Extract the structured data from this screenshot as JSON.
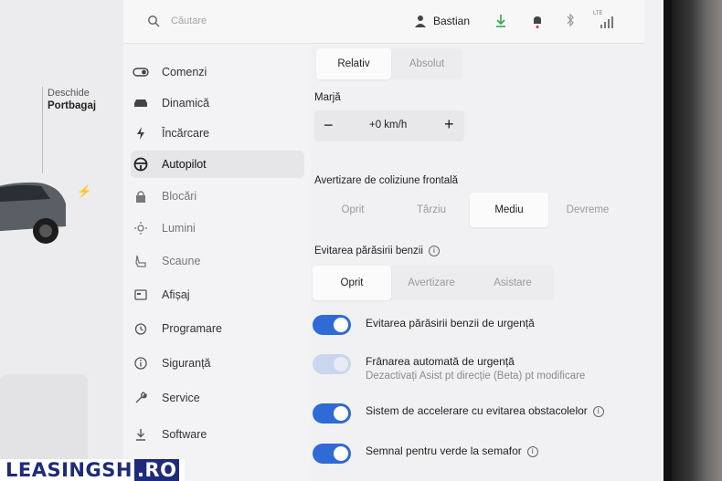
{
  "topbar": {
    "search_placeholder": "Căutare",
    "user_name": "Bastian",
    "signal_label": "LTE"
  },
  "car_panel": {
    "trunk_line1": "Deschide",
    "trunk_line2": "Portbagaj"
  },
  "menu": {
    "items": [
      {
        "label": "Comenzi",
        "icon": "toggle-icon"
      },
      {
        "label": "Dinamică",
        "icon": "car-icon"
      },
      {
        "label": "Încărcare",
        "icon": "bolt-icon"
      },
      {
        "label": "Autopilot",
        "icon": "steering-wheel-icon"
      },
      {
        "label": "Blocări",
        "icon": "lock-icon"
      },
      {
        "label": "Lumini",
        "icon": "light-icon"
      },
      {
        "label": "Scaune",
        "icon": "seat-icon"
      },
      {
        "label": "Afișaj",
        "icon": "display-icon"
      },
      {
        "label": "Programare",
        "icon": "clock-icon"
      },
      {
        "label": "Siguranță",
        "icon": "info-icon"
      },
      {
        "label": "Service",
        "icon": "wrench-icon"
      },
      {
        "label": "Software",
        "icon": "download-icon"
      }
    ],
    "active_index": 3
  },
  "main": {
    "speed_mode": {
      "options": [
        "Relativ",
        "Absolut"
      ],
      "selected": "Relativ"
    },
    "margin_label": "Marjă",
    "margin_value": "+0 km/h",
    "fcw_label": "Avertizare de coliziune frontală",
    "fcw": {
      "options": [
        "Oprit",
        "Târziu",
        "Mediu",
        "Devreme"
      ],
      "selected": "Mediu"
    },
    "lane_label": "Evitarea părăsirii benzii",
    "lane": {
      "options": [
        "Oprit",
        "Avertizare",
        "Asistare"
      ],
      "selected": "Oprit"
    },
    "toggles": [
      {
        "title": "Evitarea părăsirii benzii de urgență",
        "subtitle": "",
        "on": true,
        "enabled": true,
        "info": false
      },
      {
        "title": "Frânarea automată de urgență",
        "subtitle": "Dezactivați Asist pt direcție (Beta) pt modificare",
        "on": true,
        "enabled": false,
        "info": false
      },
      {
        "title": "Sistem de accelerare cu evitarea obstacolelor",
        "subtitle": "",
        "on": true,
        "enabled": true,
        "info": true
      },
      {
        "title": "Semnal pentru verde la semafor",
        "subtitle": "",
        "on": true,
        "enabled": true,
        "info": true
      }
    ]
  },
  "watermark": {
    "main": "LEASINGSH",
    "suffix": ".RO"
  },
  "colors": {
    "accent": "#2f6bd6",
    "background": "#f1f1f3",
    "watermark": "#1e2a7a"
  }
}
